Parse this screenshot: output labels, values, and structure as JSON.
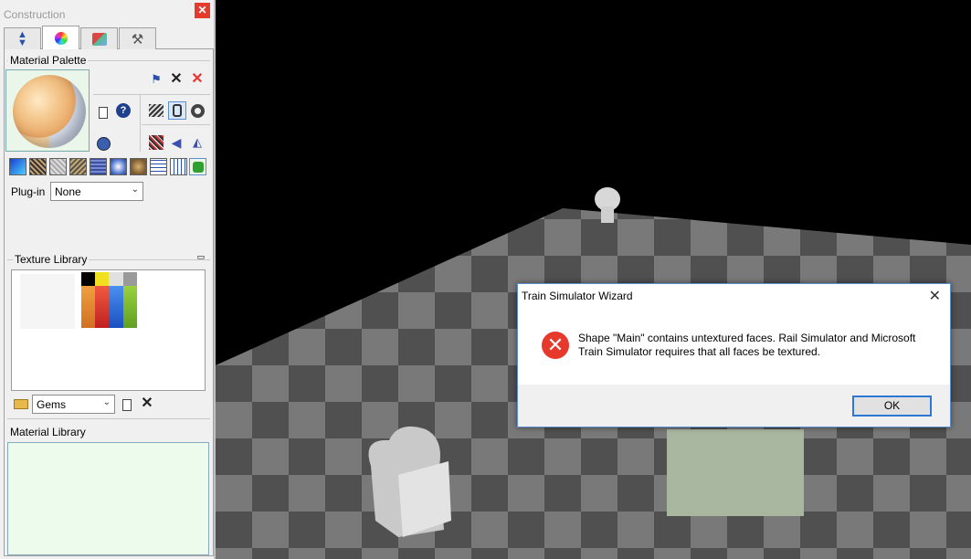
{
  "panel": {
    "title": "Construction",
    "close_icon": "close-icon",
    "tabs": [
      {
        "name": "tab-arrows",
        "icon": "updown-arrows-icon"
      },
      {
        "name": "tab-materials",
        "icon": "color-wheel-icon"
      },
      {
        "name": "tab-shapes",
        "icon": "cubes-icon"
      },
      {
        "name": "tab-tools",
        "icon": "tools-icon"
      }
    ],
    "material_palette_label": "Material Palette",
    "plugin_label": "Plug-in",
    "plugin_value": "None",
    "texture_library_label": "Texture Library",
    "gems_value": "Gems",
    "material_library_label": "Material Library"
  },
  "dialog": {
    "title": "Train Simulator Wizard",
    "message": "Shape \"Main\" contains untextured faces. Rail Simulator and Microsoft Train Simulator requires that all faces be textured.",
    "ok_label": "OK",
    "icon": "error-icon"
  },
  "colors": {
    "accent": "#2b79d4",
    "error": "#e6382b",
    "floor_light": "#8c8c8c",
    "floor_dark": "#5a5a5a"
  }
}
